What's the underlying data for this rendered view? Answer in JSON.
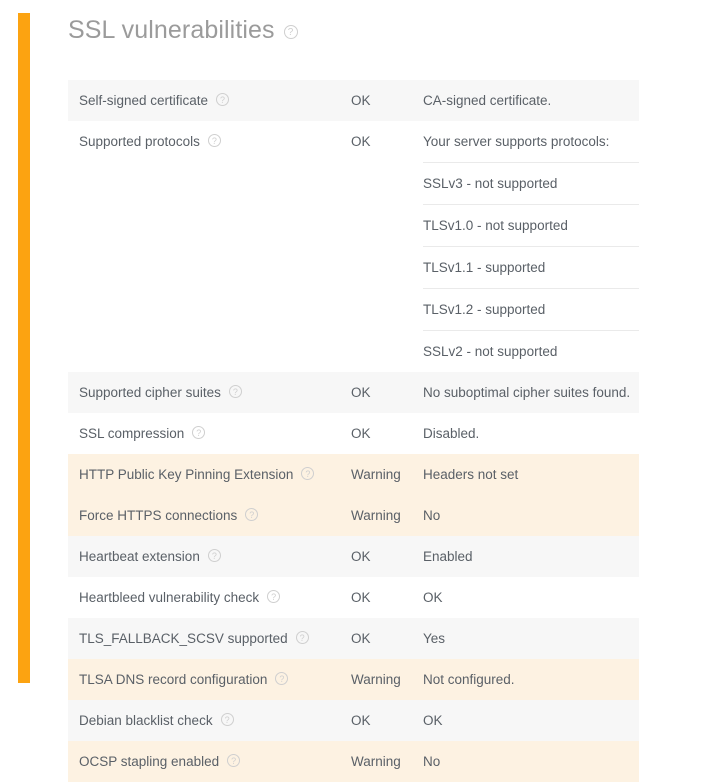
{
  "accent_color": "#fca311",
  "header": {
    "title": "SSL vulnerabilities",
    "help_icon": "help-circle-icon"
  },
  "table": {
    "rows": [
      {
        "name": "Self-signed certificate",
        "help_icon": "help-circle-icon",
        "status": "OK",
        "severity": "ok",
        "values": [
          "CA-signed certificate."
        ]
      },
      {
        "name": "Supported protocols",
        "help_icon": "help-circle-icon",
        "status": "OK",
        "severity": "ok",
        "values": [
          "Your server supports protocols:",
          "SSLv3 - not supported",
          "TLSv1.0 - not supported",
          "TLSv1.1 - supported",
          "TLSv1.2 - supported",
          "SSLv2 - not supported"
        ]
      },
      {
        "name": "Supported cipher suites",
        "help_icon": "help-circle-icon",
        "status": "OK",
        "severity": "ok",
        "values": [
          "No suboptimal cipher suites found."
        ]
      },
      {
        "name": "SSL compression",
        "help_icon": "help-circle-icon",
        "status": "OK",
        "severity": "ok",
        "values": [
          "Disabled."
        ]
      },
      {
        "name": "HTTP Public Key Pinning Extension",
        "help_icon": "help-circle-icon",
        "status": "Warning",
        "severity": "warning",
        "values": [
          "Headers not set"
        ]
      },
      {
        "name": "Force HTTPS connections",
        "help_icon": "help-circle-icon",
        "status": "Warning",
        "severity": "warning",
        "values": [
          "No"
        ]
      },
      {
        "name": "Heartbeat extension",
        "help_icon": "help-circle-icon",
        "status": "OK",
        "severity": "ok",
        "values": [
          "Enabled"
        ]
      },
      {
        "name": "Heartbleed vulnerability check",
        "help_icon": "help-circle-icon",
        "status": "OK",
        "severity": "ok",
        "values": [
          "OK"
        ]
      },
      {
        "name": "TLS_FALLBACK_SCSV supported",
        "help_icon": "help-circle-icon",
        "status": "OK",
        "severity": "ok",
        "values": [
          "Yes"
        ]
      },
      {
        "name": "TLSA DNS record configuration",
        "help_icon": "help-circle-icon",
        "status": "Warning",
        "severity": "warning",
        "values": [
          "Not configured."
        ]
      },
      {
        "name": "Debian blacklist check",
        "help_icon": "help-circle-icon",
        "status": "OK",
        "severity": "ok",
        "values": [
          "OK"
        ]
      },
      {
        "name": "OCSP stapling enabled",
        "help_icon": "help-circle-icon",
        "status": "Warning",
        "severity": "warning",
        "values": [
          "No"
        ]
      }
    ]
  },
  "icon_glyphs": {
    "help": "?"
  }
}
